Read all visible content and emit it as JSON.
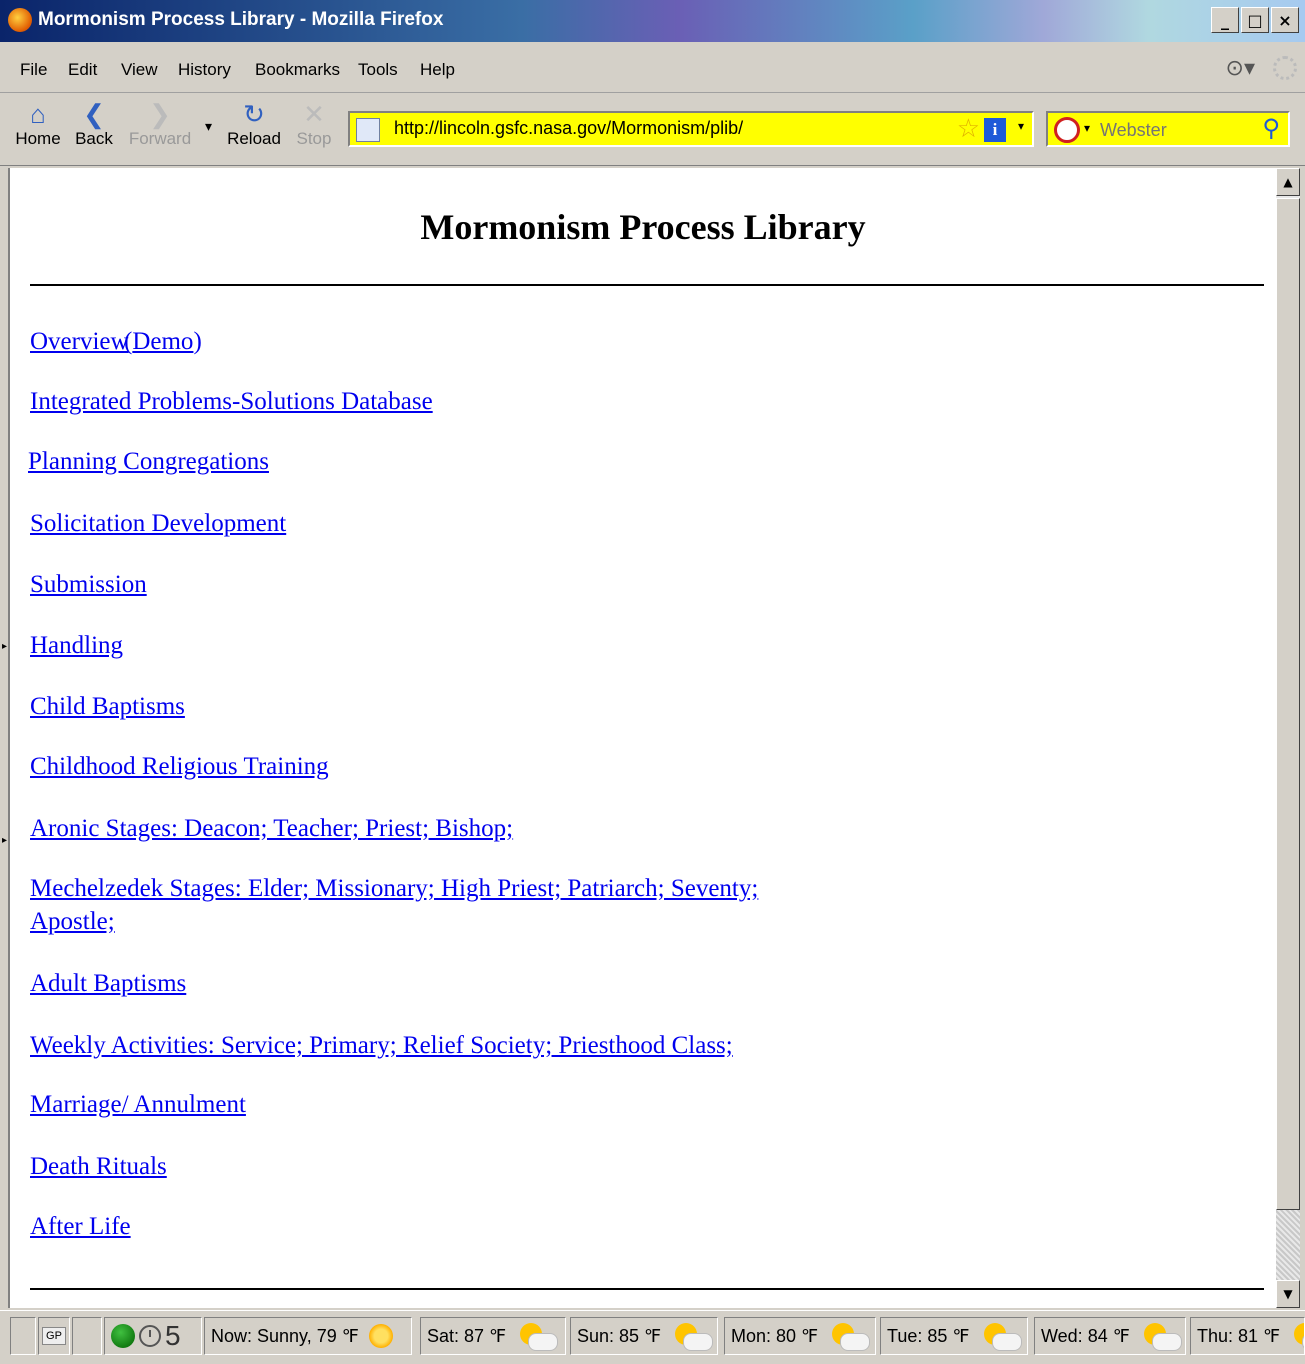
{
  "window": {
    "title": "Mormonism Process Library - Mozilla Firefox",
    "controls": [
      "_",
      "□",
      "×"
    ]
  },
  "menu": [
    "File",
    "Edit",
    "View",
    "History",
    "Bookmarks",
    "Tools",
    "Help"
  ],
  "toolbar": {
    "home": "Home",
    "back": "Back",
    "forward": "Forward",
    "reload": "Reload",
    "stop": "Stop",
    "url": "http://lincoln.gsfc.nasa.gov/Mormonism/plib/",
    "search_placeholder": "Webster"
  },
  "page": {
    "title": "Mormonism Process Library",
    "links": [
      {
        "text": "Overview"
      },
      {
        "text": "Demo"
      },
      {
        "text": "Integrated Problems-Solutions Database"
      },
      {
        "text": "Planning Congregations"
      },
      {
        "text": "Solicitation Development"
      },
      {
        "text": "Submission"
      },
      {
        "text": "Handling"
      },
      {
        "text": "Child Baptisms"
      },
      {
        "text": "Childhood Religious Training"
      },
      {
        "text": "Aronic Stages: Deacon; Teacher; Priest; Bishop;"
      },
      {
        "text": "Mechelzedek Stages: Elder; Missionary; High Priest; Patriarch; Seventy;"
      },
      {
        "text": "Apostle;"
      },
      {
        "text": "Adult Baptisms"
      },
      {
        "text": "Weekly Activities: Service; Primary; Relief Society; Priesthood Class;"
      },
      {
        "text": "Marriage/ Annulment"
      },
      {
        "text": "Death Rituals"
      },
      {
        "text": "After Life"
      }
    ]
  },
  "status": {
    "gp": "GP",
    "count": "5",
    "weather": [
      {
        "text": "Now: Sunny, 79 ℉",
        "icon": "sunny-icon"
      },
      {
        "text": "Sat: 87 ℉",
        "icon": "partly-cloudy-icon"
      },
      {
        "text": "Sun: 85 ℉",
        "icon": "partly-cloudy-icon"
      },
      {
        "text": "Mon: 80 ℉",
        "icon": "partly-cloudy-icon"
      },
      {
        "text": "Tue: 85 ℉",
        "icon": "partly-cloudy-icon"
      },
      {
        "text": "Wed: 84 ℉",
        "icon": "partly-cloudy-icon"
      },
      {
        "text": "Thu: 81 ℉",
        "icon": "partly-cloudy-icon"
      }
    ]
  }
}
